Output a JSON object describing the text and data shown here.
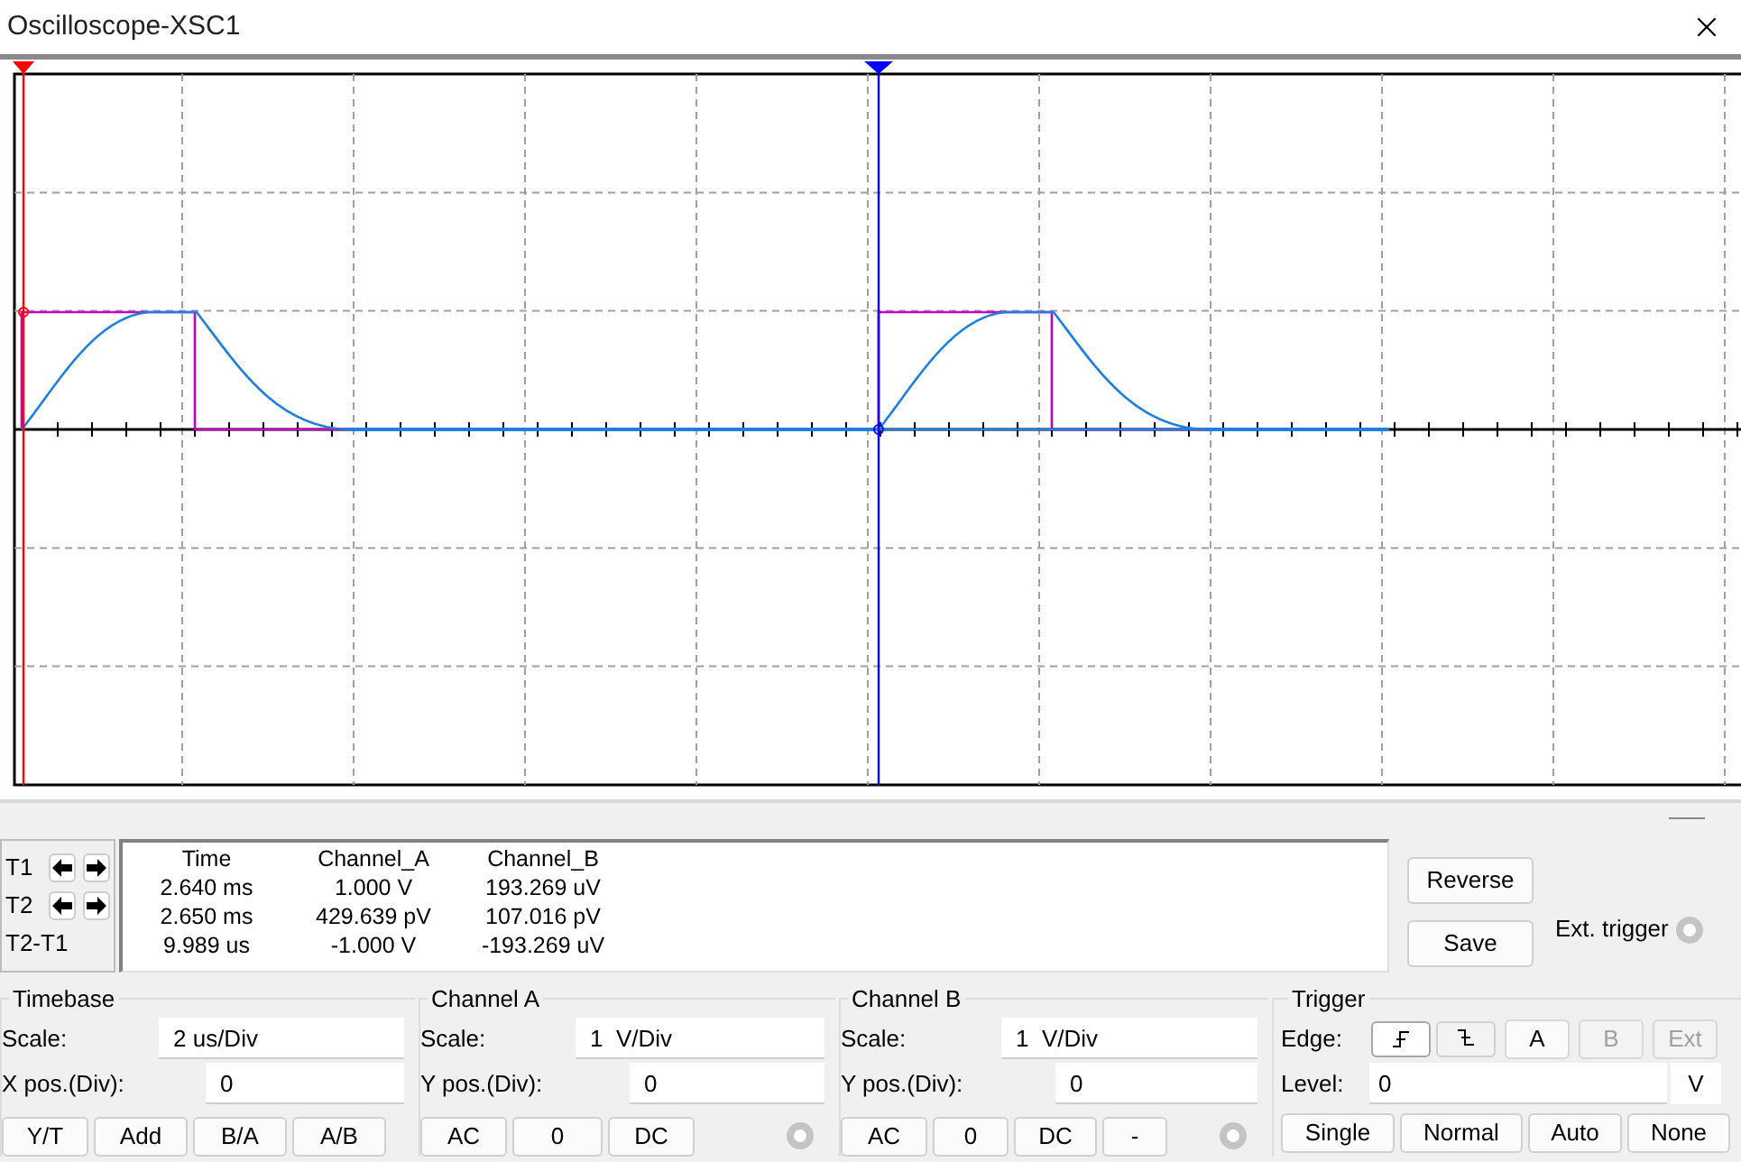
{
  "window": {
    "title": "Oscilloscope-XSC1"
  },
  "cursor_controls": [
    {
      "label": "T1",
      "kind": "arrows"
    },
    {
      "label": "T2",
      "kind": "arrows"
    },
    {
      "label": "T2-T1",
      "kind": "plain"
    }
  ],
  "readout": {
    "columns": [
      "Time",
      "Channel_A",
      "Channel_B"
    ],
    "rows": [
      [
        "2.640 ms",
        "1.000 V",
        "193.269 uV"
      ],
      [
        "2.650 ms",
        "429.639 pV",
        "107.016 pV"
      ],
      [
        "9.989 us",
        "-1.000 V",
        "-193.269 uV"
      ]
    ]
  },
  "buttons": [
    "Reverse",
    "Save"
  ],
  "ext_trigger": {
    "label": "Ext. trigger"
  },
  "timebase": {
    "title": "Timebase",
    "fields": [
      {
        "label": "Scale:",
        "value": "2 us/Div"
      },
      {
        "label": "X pos.(Div):",
        "value": "0"
      }
    ],
    "buttons": [
      "Y/T",
      "Add",
      "B/A",
      "A/B"
    ]
  },
  "channel_a": {
    "title": "Channel A",
    "fields": [
      {
        "label": "Scale:",
        "value": "1  V/Div"
      },
      {
        "label": "Y pos.(Div):",
        "value": "0"
      }
    ],
    "buttons": [
      "AC",
      "0",
      "DC"
    ]
  },
  "channel_b": {
    "title": "Channel B",
    "fields": [
      {
        "label": "Scale:",
        "value": "1  V/Div"
      },
      {
        "label": "Y pos.(Div):",
        "value": "0"
      }
    ],
    "buttons": [
      "AC",
      "0",
      "DC",
      "-"
    ]
  },
  "trigger": {
    "title": "Trigger",
    "edge_label": "Edge:",
    "edges": [
      {
        "kind": "rising",
        "selected": true
      },
      {
        "kind": "falling",
        "selected": false
      }
    ],
    "sources": [
      {
        "label": "A",
        "disabled": false
      },
      {
        "label": "B",
        "disabled": true
      },
      {
        "label": "Ext",
        "disabled": true
      }
    ],
    "level_label": "Level:",
    "level_value": "0",
    "level_unit": "V",
    "modes": [
      "Single",
      "Normal",
      "Auto",
      "None"
    ]
  }
}
